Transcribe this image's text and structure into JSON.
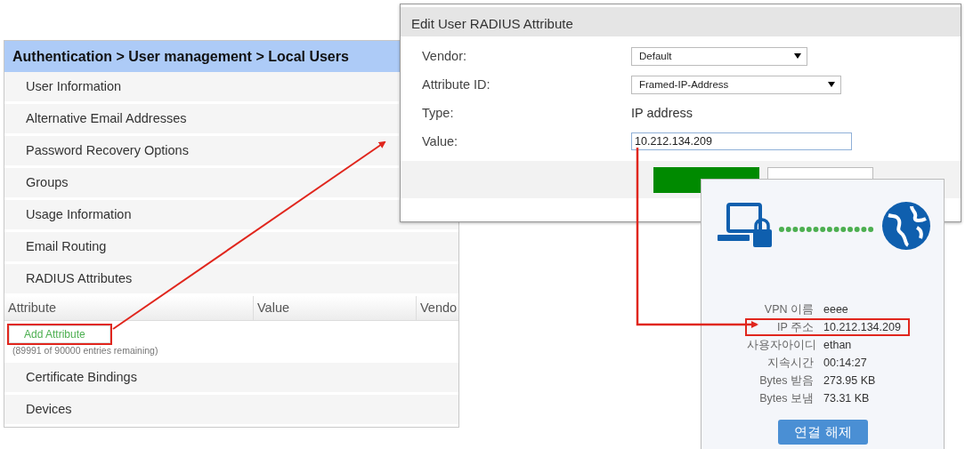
{
  "local_users": {
    "breadcrumb": "Authentication > User management > Local Users",
    "sections": [
      {
        "kind": "section",
        "label": "User Information"
      },
      {
        "kind": "section",
        "label": "Alternative Email Addresses"
      },
      {
        "kind": "section",
        "label": "Password Recovery Options"
      },
      {
        "kind": "section",
        "label": "Groups"
      },
      {
        "kind": "section",
        "label": "Usage Information"
      },
      {
        "kind": "section",
        "label": "Email Routing"
      },
      {
        "kind": "section",
        "label": "RADIUS Attributes"
      },
      {
        "kind": "table",
        "columns": [
          "Attribute",
          "Value",
          "Vendo"
        ],
        "add_button": {
          "label": "Add Attribute",
          "highlighted": true
        },
        "remaining": "(89991 of 90000 entries remaining)"
      },
      {
        "kind": "section",
        "label": "Certificate Bindings"
      },
      {
        "kind": "section",
        "label": "Devices"
      }
    ]
  },
  "dialog": {
    "title": "Edit User RADIUS Attribute",
    "fields": [
      {
        "kind": "select",
        "label": "Vendor:",
        "value": "Default"
      },
      {
        "kind": "select",
        "label": "Attribute ID:",
        "value": "Framed-IP-Address"
      },
      {
        "kind": "text",
        "label": "Type:",
        "value": "IP address"
      },
      {
        "kind": "input",
        "label": "Value:",
        "value": "10.212.134.209"
      }
    ],
    "buttons": [
      {
        "kind": "primary"
      },
      {
        "kind": "secondary"
      }
    ]
  },
  "vpn_status": {
    "details": [
      {
        "label": "VPN 이름",
        "value": "eeee",
        "highlighted": false
      },
      {
        "label": "IP 주소",
        "value": "10.212.134.209",
        "highlighted": true
      },
      {
        "label": "사용자아이디",
        "value": "ethan",
        "highlighted": false
      },
      {
        "label": "지속시간",
        "value": "00:14:27",
        "highlighted": false
      },
      {
        "label": "Bytes 받음",
        "value": "273.95 KB",
        "highlighted": false
      },
      {
        "label": "Bytes 보냄",
        "value": "73.31 KB",
        "highlighted": false
      }
    ],
    "disconnect_button": "연결 해제"
  }
}
